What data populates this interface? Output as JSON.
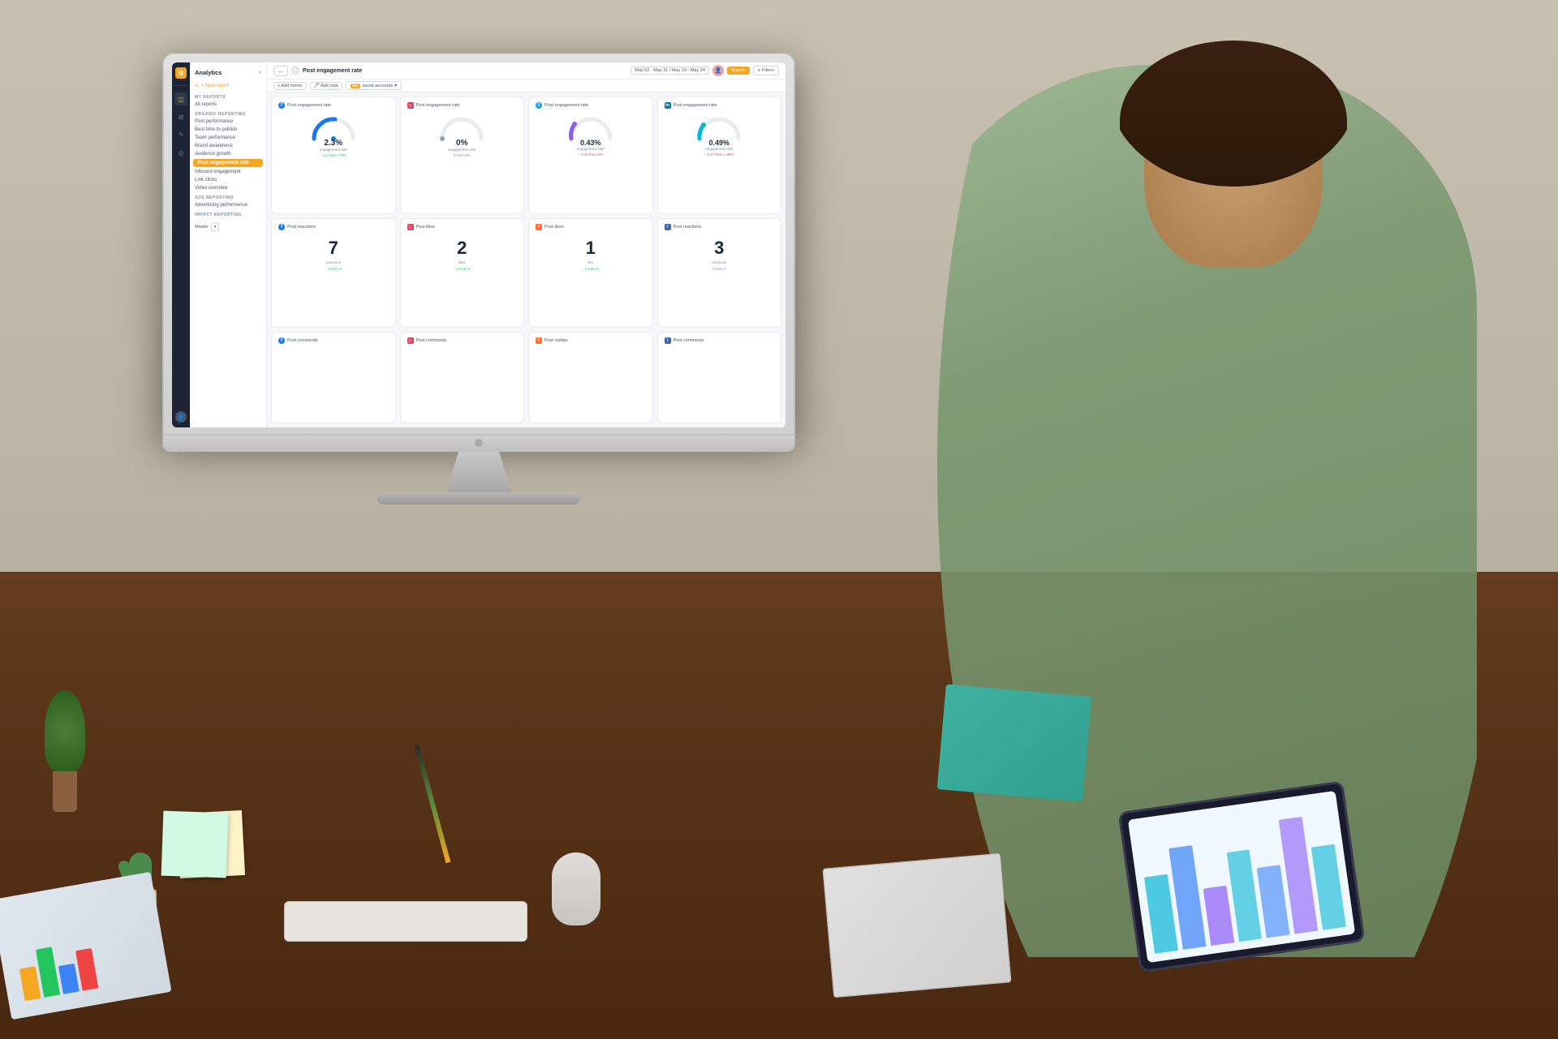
{
  "app": {
    "title": "Analytics",
    "logo": "B"
  },
  "sidebar_icons": [
    {
      "name": "home-icon",
      "symbol": "⌂",
      "active": false
    },
    {
      "name": "analytics-icon",
      "symbol": "📊",
      "active": true
    },
    {
      "name": "calendar-icon",
      "symbol": "📅",
      "active": false
    },
    {
      "name": "users-icon",
      "symbol": "👥",
      "active": false
    },
    {
      "name": "settings-icon",
      "symbol": "⚙",
      "active": false
    }
  ],
  "nav": {
    "new_report": "+ New report",
    "sections": [
      {
        "label": "MY REPORTS",
        "items": [
          "All reports"
        ]
      },
      {
        "label": "ORGANIC REPORTING",
        "items": [
          "Post performance",
          "Best time to publish",
          "Team performance",
          "Brand awareness",
          "Audience growth",
          "Post engagement rate",
          "Inbound engagement",
          "Link clicks",
          "Video overview"
        ]
      },
      {
        "label": "ADS REPORTING",
        "items": [
          "Advertising performance"
        ]
      },
      {
        "label": "IMPACT REPORTING",
        "items": []
      }
    ],
    "active_item": "Post engagement rate",
    "workspace_label": "Master",
    "workspace_dropdown": true
  },
  "header": {
    "back_label": "←",
    "title": "Post engagement rate",
    "date_range": "May 02 - May 31 / May 19 - May 24",
    "avatar_btn": "👤",
    "export_btn": "Export",
    "filter_btn": "Filters"
  },
  "toolbar": {
    "add_metric_label": "+ Add metric",
    "add_note_label": "🖊 Add note",
    "social_accounts_label": "21+ social accounts",
    "social_accounts_count": "21+"
  },
  "metric_cards": [
    {
      "id": "card-1",
      "type": "gauge",
      "platform": "facebook",
      "title": "Post engagement rate",
      "value": "2.3%",
      "sub_label": "engagement rate",
      "change_value": "↑ 5.2 from 7.5%",
      "change_type": "up",
      "gauge_percent": 0.3,
      "gauge_color": "#1877f2"
    },
    {
      "id": "card-2",
      "type": "gauge",
      "platform": "other",
      "title": "Post engagement rate",
      "value": "0%",
      "sub_label": "engagement rate",
      "change_value": "0 from 0%",
      "change_type": "neutral",
      "gauge_percent": 0,
      "gauge_color": "#94a3b8"
    },
    {
      "id": "card-3",
      "type": "gauge",
      "platform": "other2",
      "title": "Post engagement rate",
      "value": "0.43%",
      "sub_label": "engagement rate",
      "change_value": "↓ 0.43 from 0%",
      "change_type": "down",
      "gauge_percent": 0.05,
      "gauge_color": "#8b5cf6"
    },
    {
      "id": "card-4",
      "type": "gauge",
      "platform": "other3",
      "title": "Post engagement rate",
      "value": "0.49%",
      "sub_label": "engagement rate",
      "change_value": "↓ 1.17 from 1.66%",
      "change_type": "down",
      "gauge_percent": 0.06,
      "gauge_color": "#06b6d4"
    },
    {
      "id": "card-5",
      "type": "number",
      "platform": "facebook",
      "title": "Post reactions",
      "value": "7",
      "value_label": "reactions",
      "change_value": "↑ 4 from 3",
      "change_type": "up"
    },
    {
      "id": "card-6",
      "type": "number",
      "platform": "other",
      "title": "Post likes",
      "value": "2",
      "value_label": "likes",
      "change_value": "↑ 2 from 0",
      "change_type": "up"
    },
    {
      "id": "card-7",
      "type": "number",
      "platform": "other2",
      "title": "Post likes",
      "value": "1",
      "value_label": "like",
      "change_value": "↑ 1 from 0",
      "change_type": "up"
    },
    {
      "id": "card-8",
      "type": "number",
      "platform": "facebook2",
      "title": "Post reactions",
      "value": "3",
      "value_label": "reactions",
      "change_value": "0 from 3",
      "change_type": "neutral"
    },
    {
      "id": "card-9",
      "type": "number_small",
      "platform": "facebook",
      "title": "Post comments",
      "value": "",
      "value_label": "",
      "change_value": "",
      "change_type": "neutral"
    },
    {
      "id": "card-10",
      "type": "number_small",
      "platform": "other",
      "title": "Post comments",
      "value": "",
      "value_label": "",
      "change_value": "",
      "change_type": "neutral"
    },
    {
      "id": "card-11",
      "type": "number_small",
      "platform": "other2",
      "title": "Post replies",
      "value": "",
      "value_label": "",
      "change_value": "",
      "change_type": "neutral"
    },
    {
      "id": "card-12",
      "type": "number_small",
      "platform": "facebook2",
      "title": "Post comments",
      "value": "",
      "value_label": "",
      "change_value": "",
      "change_type": "neutral"
    }
  ]
}
